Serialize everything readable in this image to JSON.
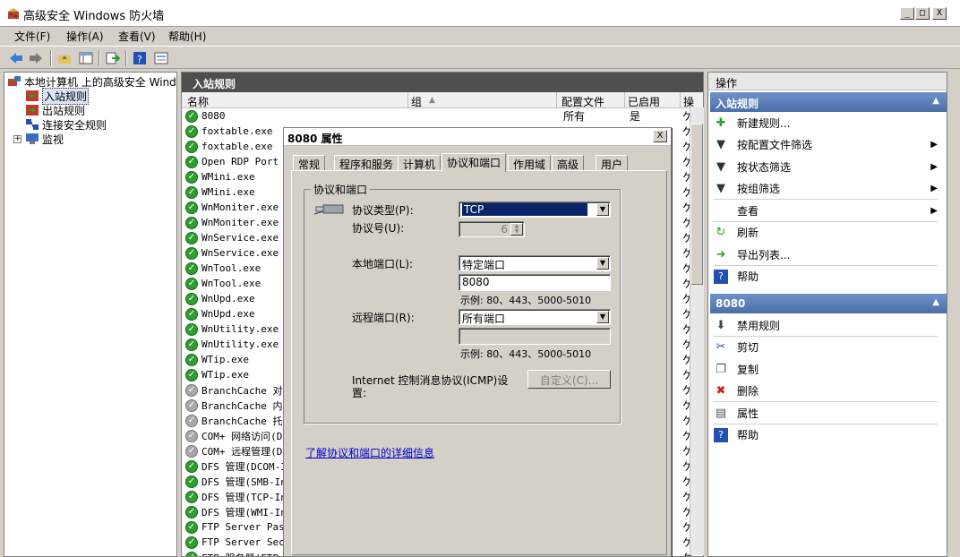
{
  "window": {
    "title": "高级安全 Windows 防火墙",
    "buttons": [
      "_",
      "□",
      "X"
    ]
  },
  "menu": [
    {
      "label": "文件(F)"
    },
    {
      "label": "操作(A)"
    },
    {
      "label": "查看(V)"
    },
    {
      "label": "帮助(H)"
    }
  ],
  "toolbar": [
    "back-icon",
    "forward-icon",
    "up-folder-icon",
    "show-hide-tree-icon",
    "export-icon",
    "help-icon",
    "properties-icon"
  ],
  "tree": {
    "root": "本地计算机 上的高级安全 Wind",
    "items": [
      "入站规则",
      "出站规则",
      "连接安全规则",
      "监视"
    ],
    "expander": "+"
  },
  "list": {
    "title": "入站规则",
    "columns": [
      "名称",
      "组",
      "配置文件",
      "已启用",
      "操"
    ],
    "rows": [
      {
        "name": "8080",
        "profile": "所有",
        "enabled": "是",
        "on": true
      },
      {
        "name": "foxtable.exe",
        "on": true
      },
      {
        "name": "foxtable.exe",
        "on": true
      },
      {
        "name": "Open RDP Port 3",
        "on": true
      },
      {
        "name": "WMini.exe",
        "on": true
      },
      {
        "name": "WMini.exe",
        "on": true
      },
      {
        "name": "WnMoniter.exe",
        "on": true
      },
      {
        "name": "WnMoniter.exe",
        "on": true
      },
      {
        "name": "WnService.exe",
        "on": true
      },
      {
        "name": "WnService.exe",
        "on": true
      },
      {
        "name": "WnTool.exe",
        "on": true
      },
      {
        "name": "WnTool.exe",
        "on": true
      },
      {
        "name": "WnUpd.exe",
        "on": true
      },
      {
        "name": "WnUpd.exe",
        "on": true
      },
      {
        "name": "WnUtility.exe",
        "on": true
      },
      {
        "name": "WnUtility.exe",
        "on": true
      },
      {
        "name": "WTip.exe",
        "on": true
      },
      {
        "name": "WTip.exe",
        "on": true
      },
      {
        "name": "BranchCache 对等",
        "on": false
      },
      {
        "name": "BranchCache 内容",
        "on": false
      },
      {
        "name": "BranchCache 托管",
        "on": false
      },
      {
        "name": "COM+ 网络访问(D",
        "on": false
      },
      {
        "name": "COM+ 远程管理(D",
        "on": false
      },
      {
        "name": "DFS 管理(DCOM-I",
        "on": true
      },
      {
        "name": "DFS 管理(SMB-In",
        "on": true
      },
      {
        "name": "DFS 管理(TCP-In",
        "on": true
      },
      {
        "name": "DFS 管理(WMI-In",
        "on": true
      },
      {
        "name": "FTP Server Pass",
        "on": true
      },
      {
        "name": "FTP Server Secu",
        "on": true
      },
      {
        "name": "FTP 服务器(FTP",
        "on": true
      }
    ],
    "action_glyph": "ケ"
  },
  "actions": {
    "title": "操作",
    "section1": "入站规则",
    "items1": [
      {
        "label": "新建规则...",
        "icon": "new-rule-icon"
      },
      {
        "label": "按配置文件筛选",
        "icon": "filter-icon",
        "sub": true
      },
      {
        "label": "按状态筛选",
        "icon": "filter-icon",
        "sub": true
      },
      {
        "label": "按组筛选",
        "icon": "filter-icon",
        "sub": true
      },
      {
        "label": "查看",
        "icon": "",
        "sub": true
      },
      {
        "label": "刷新",
        "icon": "refresh-icon"
      },
      {
        "label": "导出列表...",
        "icon": "export-icon"
      },
      {
        "label": "帮助",
        "icon": "help-icon"
      }
    ],
    "section2": "8080",
    "items2": [
      {
        "label": "禁用规则",
        "icon": "disable-icon"
      },
      {
        "label": "剪切",
        "icon": "cut-icon"
      },
      {
        "label": "复制",
        "icon": "copy-icon"
      },
      {
        "label": "删除",
        "icon": "delete-icon"
      },
      {
        "label": "属性",
        "icon": "properties-icon"
      },
      {
        "label": "帮助",
        "icon": "help-icon"
      }
    ]
  },
  "dialog": {
    "title": "8080 属性",
    "close": "X",
    "tabs": [
      "常规",
      "程序和服务",
      "计算机",
      "协议和端口",
      "作用域",
      "高级",
      "用户"
    ],
    "active_tab": "协议和端口",
    "group_title": "协议和端口",
    "protocol_type_label": "协议类型(P):",
    "protocol_type_value": "TCP",
    "protocol_number_label": "协议号(U):",
    "protocol_number_value": "6",
    "local_port_label": "本地端口(L):",
    "local_port_value": "特定端口",
    "local_port_input": "8080",
    "local_hint": "示例: 80、443、5000-5010",
    "remote_port_label": "远程端口(R):",
    "remote_port_value": "所有端口",
    "remote_port_input": "",
    "remote_hint": "示例: 80、443、5000-5010",
    "icmp_label_line1": "Internet 控制消息协议(ICMP)设",
    "icmp_label_line2": "置:",
    "customize_button": "自定义(C)...",
    "link": "了解协议和端口的详细信息"
  }
}
